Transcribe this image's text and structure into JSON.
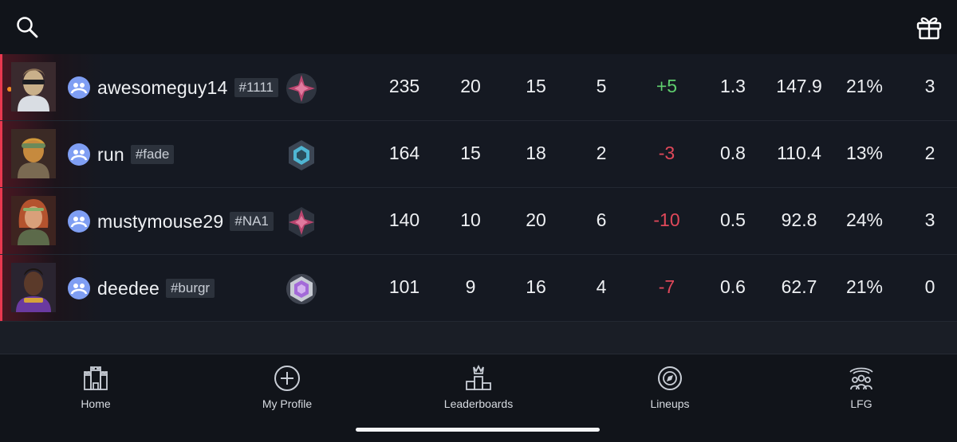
{
  "header": {
    "search_icon": "search-icon",
    "gift_icon": "gift-icon"
  },
  "players": [
    {
      "name": "awesomeguy14",
      "tag": "#1111",
      "score": "235",
      "kills": "20",
      "deaths": "15",
      "assists": "5",
      "diff": "+5",
      "kd": "1.3",
      "adr": "147.9",
      "hs": "21%",
      "last": "3",
      "diff_sign": "pos",
      "avatar_color": "#c9b08a",
      "rank_color": "#b9456e",
      "online": true
    },
    {
      "name": "run",
      "tag": "#fade",
      "score": "164",
      "kills": "15",
      "deaths": "18",
      "assists": "2",
      "diff": "-3",
      "kd": "0.8",
      "adr": "110.4",
      "hs": "13%",
      "last": "2",
      "diff_sign": "neg",
      "avatar_color": "#c68a3e",
      "rank_color": "#4fb6d3",
      "online": false
    },
    {
      "name": "mustymouse29",
      "tag": "#NA1",
      "score": "140",
      "kills": "10",
      "deaths": "20",
      "assists": "6",
      "diff": "-10",
      "kd": "0.5",
      "adr": "92.8",
      "hs": "24%",
      "last": "3",
      "diff_sign": "neg",
      "avatar_color": "#b4532e",
      "rank_color": "#b9456e",
      "online": false
    },
    {
      "name": "deedee",
      "tag": "#burgr",
      "score": "101",
      "kills": "9",
      "deaths": "16",
      "assists": "4",
      "diff": "-7",
      "kd": "0.6",
      "adr": "62.7",
      "hs": "21%",
      "last": "0",
      "diff_sign": "neg",
      "avatar_color": "#5b3a2a",
      "rank_color": "#a36ad8",
      "online": false
    }
  ],
  "nav": {
    "home": "Home",
    "profile": "My Profile",
    "leaderboards": "Leaderboards",
    "lineups": "Lineups",
    "lfg": "LFG"
  },
  "colors": {
    "accent": "#e8384f",
    "positive": "#5fce6e",
    "negative": "#e0485a"
  }
}
